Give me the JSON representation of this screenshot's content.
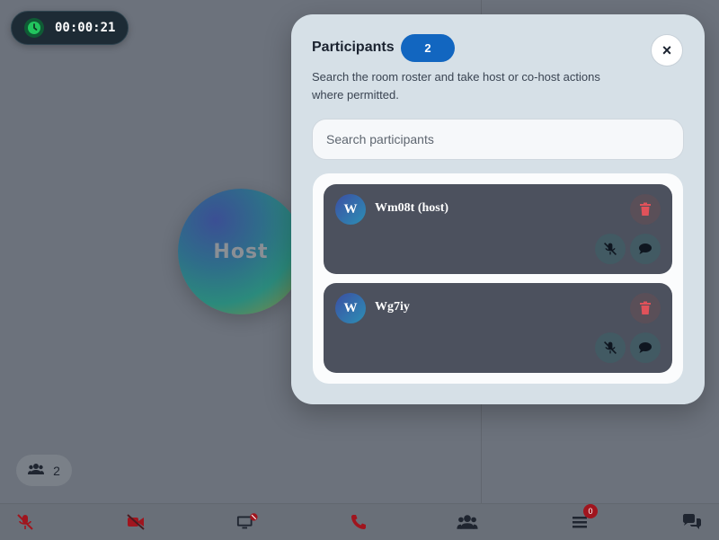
{
  "timer": {
    "value": "00:00:21",
    "icon": "clock-icon"
  },
  "main_tile": {
    "label": "Host"
  },
  "participant_pill": {
    "count": "2",
    "icon": "users-icon"
  },
  "toolbar": {
    "chat_badge": "0",
    "items": [
      "mic-muted-icon",
      "camera-off-icon",
      "screen-share-icon",
      "hangup-icon",
      "participants-icon",
      "menu-icon",
      "chat-icon"
    ]
  },
  "panel": {
    "title": "Participants",
    "count": "2",
    "close_label": "×",
    "description": "Search the room roster and take host or co-host actions where permitted.",
    "search_placeholder": "Search participants",
    "participants": [
      {
        "initial": "W",
        "name": "Wm08t (host)"
      },
      {
        "initial": "W",
        "name": "Wg7iy"
      }
    ]
  },
  "colors": {
    "accent": "#1266c0",
    "danger": "#a0151e",
    "timer_ok": "#22c55e"
  }
}
